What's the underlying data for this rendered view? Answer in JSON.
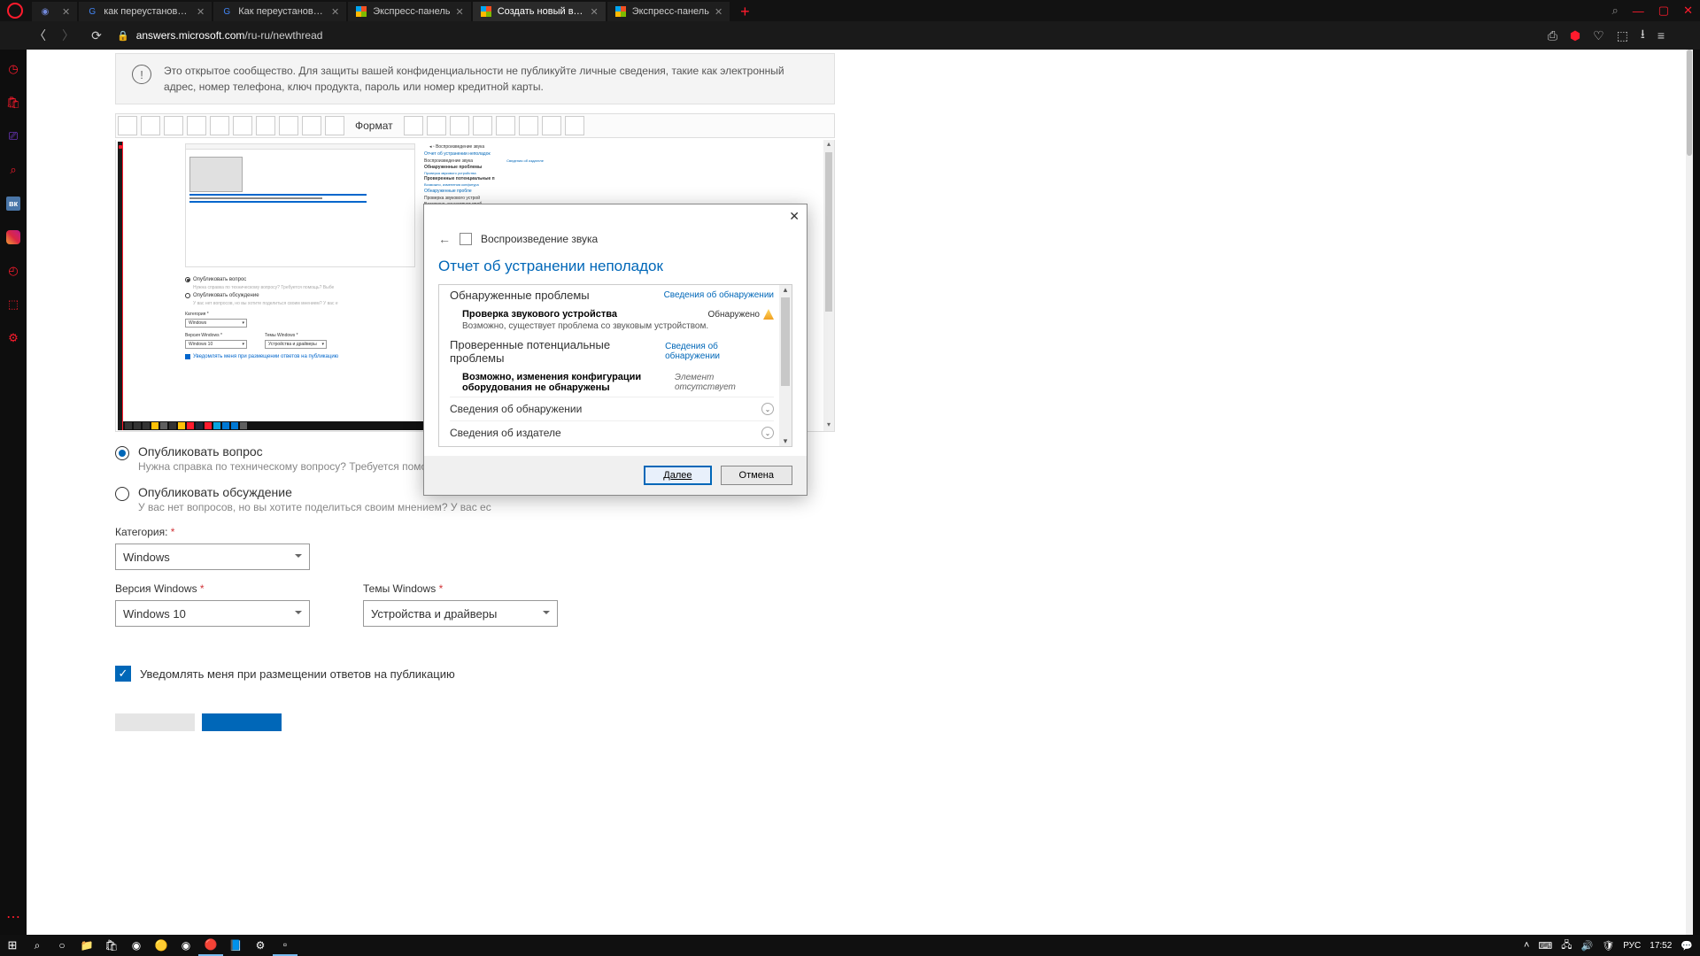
{
  "tabs": [
    {
      "title": "как переустановить windo",
      "favicon": "G"
    },
    {
      "title": "Как переустановить Windo",
      "favicon": "G"
    },
    {
      "title": "Экспресс-панель",
      "favicon": "⊞"
    },
    {
      "title": "Создать новый вопрос ил",
      "favicon": "⊞",
      "active": true
    },
    {
      "title": "Экспресс-панель",
      "favicon": "⊞"
    }
  ],
  "url": {
    "host": "answers.microsoft.com",
    "path": "/ru-ru/newthread"
  },
  "banner": "Это открытое сообщество. Для защиты вашей конфиденциальности не публикуйте личные сведения, такие как электронный адрес, номер телефона, ключ продукта, пароль или номер кредитной карты.",
  "toolbar_format": "Формат",
  "mini": {
    "ts_header": "Воспроизведение звука",
    "h": "Отчет об устранении неполадок",
    "s1": "Воспроизведение звука",
    "link": "Сведения об издателе",
    "s2": "Обнаруженные проблемы",
    "s3": "Проверка звукового устройства",
    "s4": "Проверенные потенциальные п",
    "s5": "Возможно, изменения конфигура",
    "s6": "Обнаруженные пробле",
    "s7": "Проверка звукового устрой",
    "s8": "Возможно, существует проб",
    "r1": "Опубликовать вопрос",
    "r1h": "Нужна справка по техническому вопросу? Требуется помощь? Выбе",
    "r2": "Опубликовать обсуждение",
    "r2h": "У вас нет вопросов, но вы хотите поделиться своим мнением? У вас е",
    "cat": "Категория",
    "catv": "Windows",
    "ver": "Версия Windows",
    "verv": "Windows 10",
    "top": "Темы Windows",
    "topv": "Устройства и драйверы",
    "chk": "Уведомлять меня при размещении ответов на публикацию"
  },
  "form": {
    "r1": "Опубликовать вопрос",
    "r1h": "Нужна справка по техническому вопросу? Требуется помощь? Выбери",
    "r2": "Опубликовать обсуждение",
    "r2h": "У вас нет вопросов, но вы хотите поделиться своим мнением? У вас ес",
    "cat_label": "Категория:",
    "cat_value": "Windows",
    "ver_label": "Версия Windows",
    "ver_value": "Windows 10",
    "top_label": "Темы Windows",
    "top_value": "Устройства и драйверы",
    "notify": "Уведомлять меня при размещении ответов на публикацию"
  },
  "ts": {
    "title": "Воспроизведение звука",
    "h1": "Отчет об устранении неполадок",
    "sec1": "Обнаруженные проблемы",
    "link": "Сведения об обнаружении",
    "item1": "Проверка звукового устройства",
    "status1": "Обнаружено",
    "desc1": "Возможно, существует проблема со звуковым устройством.",
    "sec2": "Проверенные потенциальные проблемы",
    "item2": "Возможно, изменения конфигурации оборудования не обнаружены",
    "status2": "Элемент отсутствует",
    "exp1": "Сведения об обнаружении",
    "exp2": "Сведения об издателе",
    "btn_next": "Далее",
    "btn_cancel": "Отмена"
  },
  "taskbar": {
    "lang": "РУС",
    "time": "17:52"
  }
}
